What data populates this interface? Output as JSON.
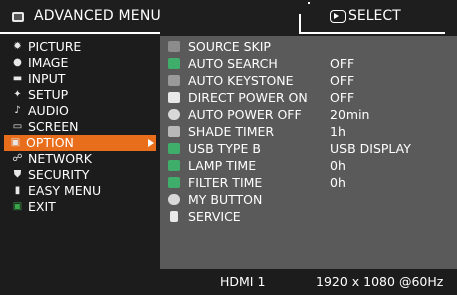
{
  "header": {
    "title": "ADVANCED MENU",
    "select_label": "SELECT",
    "select_icon": "enter-button-icon"
  },
  "menu": {
    "items": [
      {
        "label": "PICTURE",
        "icon": "picture-icon"
      },
      {
        "label": "IMAGE",
        "icon": "image-icon"
      },
      {
        "label": "INPUT",
        "icon": "input-icon"
      },
      {
        "label": "SETUP",
        "icon": "setup-icon"
      },
      {
        "label": "AUDIO",
        "icon": "audio-icon"
      },
      {
        "label": "SCREEN",
        "icon": "screen-icon"
      },
      {
        "label": "OPTION",
        "icon": "option-icon"
      },
      {
        "label": "NETWORK",
        "icon": "network-icon"
      },
      {
        "label": "SECURITY",
        "icon": "security-icon"
      },
      {
        "label": "EASY MENU",
        "icon": "easy-menu-icon"
      },
      {
        "label": "EXIT",
        "icon": "exit-icon"
      }
    ],
    "active_index": 6,
    "active_color": "#e86e1c"
  },
  "options": [
    {
      "label": "SOURCE SKIP",
      "value": "",
      "icon": "source-skip-icon"
    },
    {
      "label": "AUTO SEARCH",
      "value": "OFF",
      "icon": "auto-search-icon"
    },
    {
      "label": "AUTO KEYSTONE",
      "value": "OFF",
      "icon": "auto-keystone-icon"
    },
    {
      "label": "DIRECT POWER ON",
      "value": "OFF",
      "icon": "direct-power-on-icon"
    },
    {
      "label": "AUTO POWER OFF",
      "value": "20min",
      "icon": "auto-power-off-icon"
    },
    {
      "label": "SHADE TIMER",
      "value": "1h",
      "icon": "shade-timer-icon"
    },
    {
      "label": "USB TYPE B",
      "value": "USB DISPLAY",
      "icon": "usb-type-b-icon"
    },
    {
      "label": "LAMP TIME",
      "value": "0h",
      "icon": "lamp-time-icon"
    },
    {
      "label": "FILTER TIME",
      "value": "0h",
      "icon": "filter-time-icon"
    },
    {
      "label": "MY BUTTON",
      "value": "",
      "icon": "my-button-icon"
    },
    {
      "label": "SERVICE",
      "value": "",
      "icon": "service-icon"
    }
  ],
  "footer": {
    "source": "HDMI 1",
    "resolution": "1920 x 1080 @60Hz"
  },
  "colors": {
    "background": "#1c1c1c",
    "panel": "#5a5a5a",
    "accent": "#e86e1c",
    "text": "#ffffff"
  }
}
